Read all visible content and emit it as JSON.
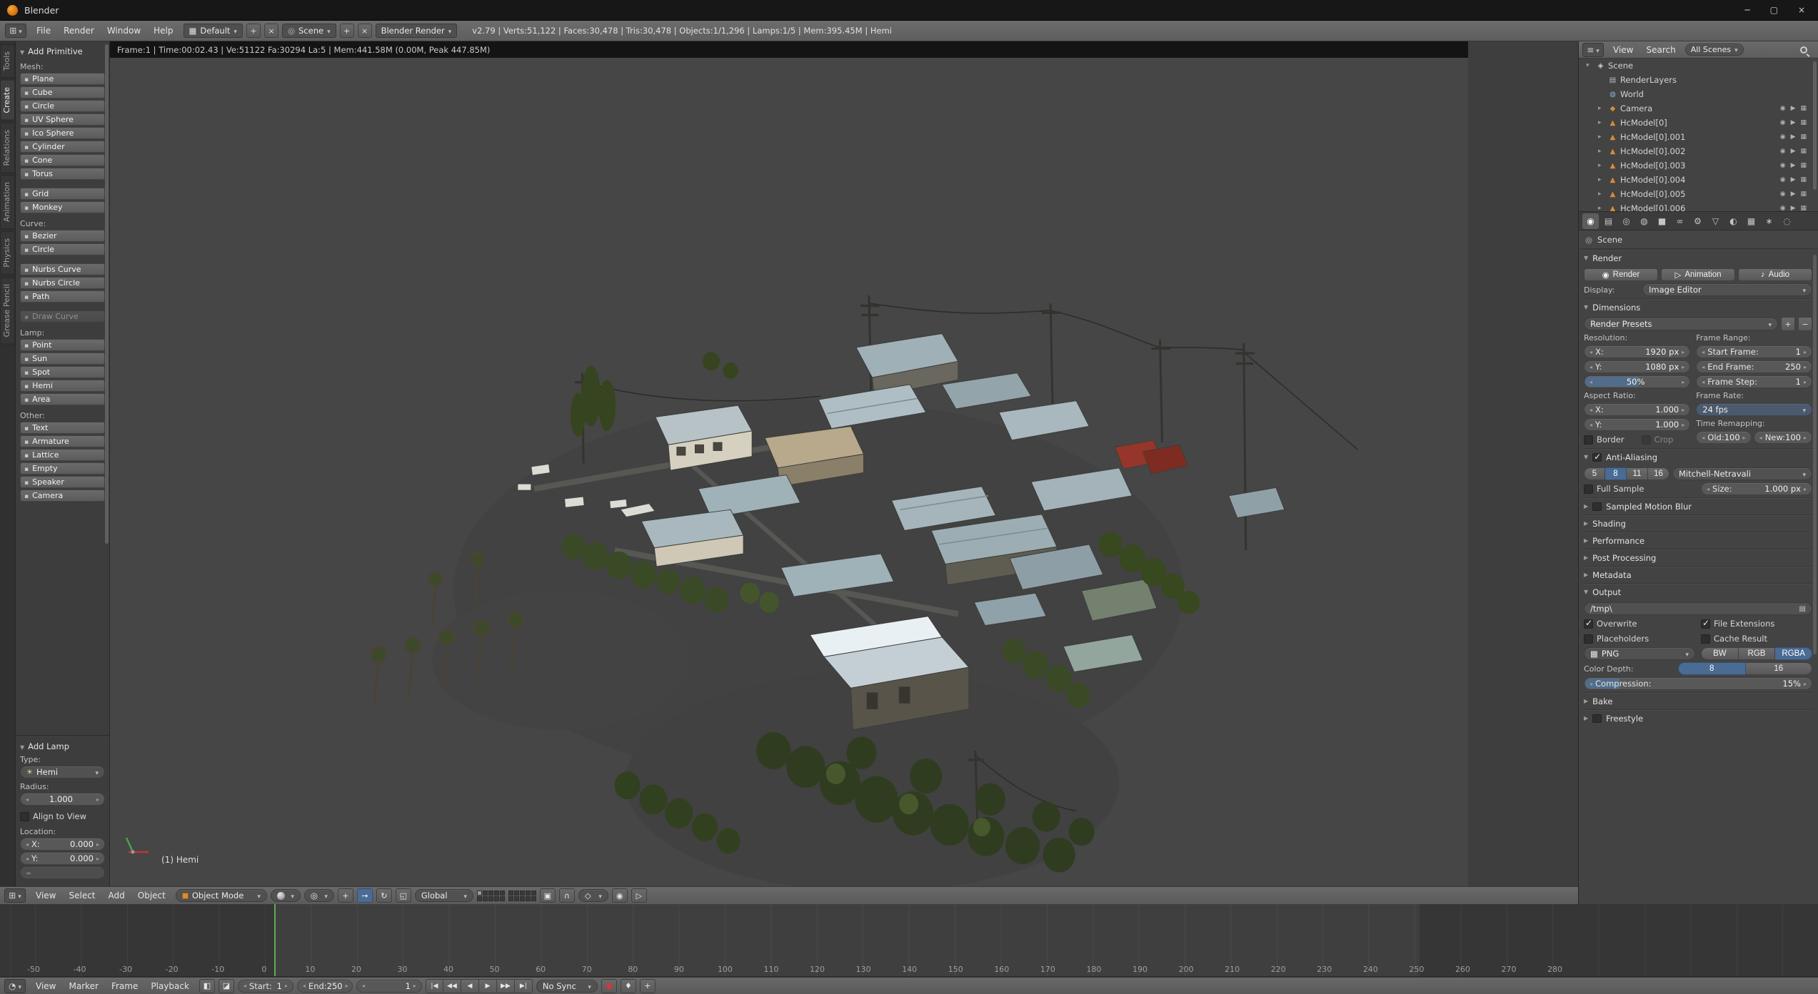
{
  "window": {
    "title": "Blender"
  },
  "info_bar": {
    "menus": [
      "File",
      "Render",
      "Window",
      "Help"
    ],
    "layout": "Default",
    "scene": "Scene",
    "engine": "Blender Render",
    "stats": "v2.79 | Verts:51,122 | Faces:30,478 | Tris:30,478 | Objects:1/1,296 | Lamps:1/5 | Mem:395.45M | Hemi"
  },
  "tool_tabs": [
    "Tools",
    "Create",
    "Relations",
    "Animation",
    "Physics",
    "Grease Pencil"
  ],
  "shelf": {
    "title": "Add Primitive",
    "mesh_label": "Mesh:",
    "mesh1": [
      "Plane",
      "Cube",
      "Circle",
      "UV Sphere",
      "Ico Sphere",
      "Cylinder",
      "Cone",
      "Torus"
    ],
    "mesh2": [
      "Grid",
      "Monkey"
    ],
    "curve_label": "Curve:",
    "curve1": [
      "Bezier",
      "Circle"
    ],
    "curve2": [
      "Nurbs Curve",
      "Nurbs Circle",
      "Path"
    ],
    "draw_curve": "Draw Curve",
    "lamp_label": "Lamp:",
    "lamp1": [
      "Point",
      "Sun",
      "Spot",
      "Hemi",
      "Area"
    ],
    "other_label": "Other:",
    "other1": [
      "Text",
      "Armature",
      "Lattice",
      "Empty",
      "Speaker",
      "Camera"
    ]
  },
  "add_lamp": {
    "title": "Add Lamp",
    "type_label": "Type:",
    "type_value": "Hemi",
    "radius_label": "Radius:",
    "radius_value": "1.000",
    "align": "Align to View",
    "location_label": "Location:",
    "x_label": "X:",
    "x_value": "0.000",
    "y_label": "Y:",
    "y_value": "0.000"
  },
  "viewport": {
    "render_stats": "Frame:1 | Time:00:02.43 | Ve:51122 Fa:30294 La:5 | Mem:441.58M (0.00M, Peak 447.85M)",
    "active_object": "(1) Hemi",
    "menus": [
      "View",
      "Select",
      "Add",
      "Object"
    ],
    "mode": "Object Mode",
    "orientation": "Global"
  },
  "outliner": {
    "menus": [
      "View",
      "Search"
    ],
    "display_mode": "All Scenes",
    "rows": [
      {
        "caret": "▾",
        "icon": "◈",
        "name": "Scene"
      },
      {
        "caret": "",
        "icon": "▤",
        "name": "RenderLayers"
      },
      {
        "caret": "",
        "icon": "◍",
        "name": "World"
      },
      {
        "caret": "▸",
        "icon": "◆",
        "name": "Camera"
      },
      {
        "caret": "▸",
        "icon": "▲",
        "name": "HcModel[0]"
      },
      {
        "caret": "▸",
        "icon": "▲",
        "name": "HcModel[0].001"
      },
      {
        "caret": "▸",
        "icon": "▲",
        "name": "HcModel[0].002"
      },
      {
        "caret": "▸",
        "icon": "▲",
        "name": "HcModel[0].003"
      },
      {
        "caret": "▸",
        "icon": "▲",
        "name": "HcModel[0].004"
      },
      {
        "caret": "▸",
        "icon": "▲",
        "name": "HcModel[0].005"
      },
      {
        "caret": "▸",
        "icon": "▲",
        "name": "HcModel[0].006"
      }
    ]
  },
  "properties": {
    "tabs": [
      "◉",
      "▤",
      "◎",
      "◍",
      "■",
      "∞",
      "⚙",
      "▽",
      "◐",
      "▦",
      "∗",
      "◌"
    ],
    "context": "Scene",
    "render": {
      "title": "Render",
      "render_btn": "Render",
      "animation_btn": "Animation",
      "audio_btn": "Audio",
      "display_label": "Display:",
      "display_value": "Image Editor"
    },
    "dimensions": {
      "title": "Dimensions",
      "presets": "Render Presets",
      "resolution_label": "Resolution:",
      "res_x_label": "X:",
      "res_x": "1920 px",
      "res_y_label": "Y:",
      "res_y": "1080 px",
      "res_pct": "50%",
      "aspect_label": "Aspect Ratio:",
      "asp_x_label": "X:",
      "asp_x": "1.000",
      "asp_y_label": "Y:",
      "asp_y": "1.000",
      "border": "Border",
      "crop": "Crop",
      "range_label": "Frame Range:",
      "start_label": "Start Frame:",
      "start": "1",
      "end_label": "End Frame:",
      "end": "250",
      "step_label": "Frame Step:",
      "step": "1",
      "rate_label": "Frame Rate:",
      "fps": "24 fps",
      "remap_label": "Time Remapping:",
      "old_label": "Old:",
      "old": "100",
      "new_label": "New:",
      "new": "100"
    },
    "aa": {
      "title": "Anti-Aliasing",
      "samples": [
        "5",
        "8",
        "11",
        "16"
      ],
      "filter": "Mitchell-Netravali",
      "full_sample": "Full Sample",
      "size_label": "Size:",
      "size": "1.000 px"
    },
    "collapsed": {
      "motion_blur": "Sampled Motion Blur",
      "shading": "Shading",
      "performance": "Performance",
      "post": "Post Processing",
      "metadata": "Metadata",
      "bake": "Bake",
      "freestyle": "Freestyle"
    },
    "output": {
      "title": "Output",
      "path": "/tmp\\",
      "overwrite": "Overwrite",
      "file_ext": "File Extensions",
      "placeholders": "Placeholders",
      "cache": "Cache Result",
      "format": "PNG",
      "channels": [
        "BW",
        "RGB",
        "RGBA"
      ],
      "depth_label": "Color Depth:",
      "depths": [
        "8",
        "16"
      ],
      "compression_label": "Compression:",
      "compression": "15%"
    }
  },
  "timeline": {
    "ticks": [
      "-50",
      "-40",
      "-30",
      "-20",
      "-10",
      "0",
      "10",
      "20",
      "30",
      "40",
      "50",
      "60",
      "70",
      "80",
      "90",
      "100",
      "110",
      "120",
      "130",
      "140",
      "150",
      "160",
      "170",
      "180",
      "190",
      "200",
      "210",
      "220",
      "230",
      "240",
      "250",
      "260",
      "270",
      "280"
    ],
    "menus": [
      "View",
      "Marker",
      "Frame",
      "Playback"
    ],
    "start_label": "Start:",
    "start": "1",
    "end_label": "End:",
    "end": "250",
    "frame": "1",
    "sync": "No Sync"
  }
}
